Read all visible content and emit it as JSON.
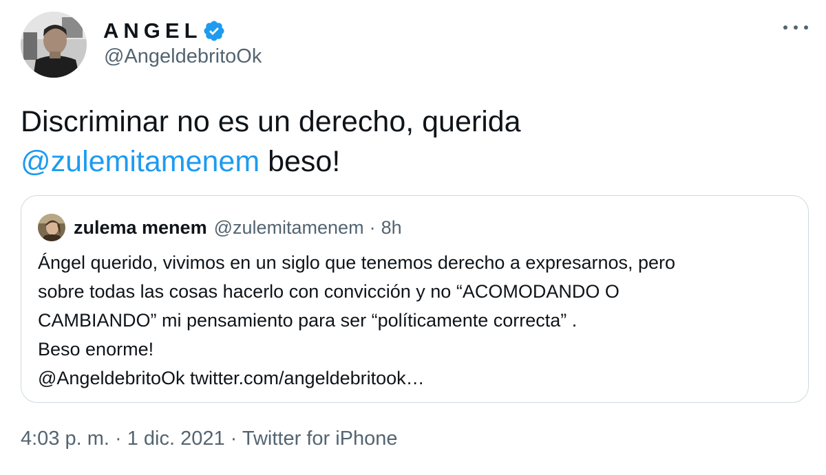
{
  "author": {
    "display_name": "ANGEL",
    "handle": "@AngeldebritoOk",
    "verified": true
  },
  "tweet": {
    "text_part1": "Discriminar no es un derecho, querida",
    "mention": "@zulemitamenem",
    "text_part2": " beso!"
  },
  "quoted_tweet": {
    "display_name": "zulema menem",
    "handle": "@zulemitamenem",
    "separator": "·",
    "time": "8h",
    "lines": [
      "Ángel querido, vivimos en un siglo que tenemos derecho a expresarnos, pero",
      "sobre todas las cosas hacerlo con convicción y no “ACOMODANDO O",
      "CAMBIANDO” mi pensamiento para ser “políticamente correcta” .",
      "Beso enorme!",
      "@AngeldebritoOk twitter.com/angeldebritook…"
    ]
  },
  "footer": {
    "text": "4:03 p. m. · 1 dic. 2021 · Twitter for iPhone"
  },
  "colors": {
    "link": "#1d9bf0",
    "secondary_text": "#536471",
    "border": "#cfd9de"
  },
  "icons": {
    "verified": "verified-badge-icon",
    "more": "more-options-icon"
  }
}
